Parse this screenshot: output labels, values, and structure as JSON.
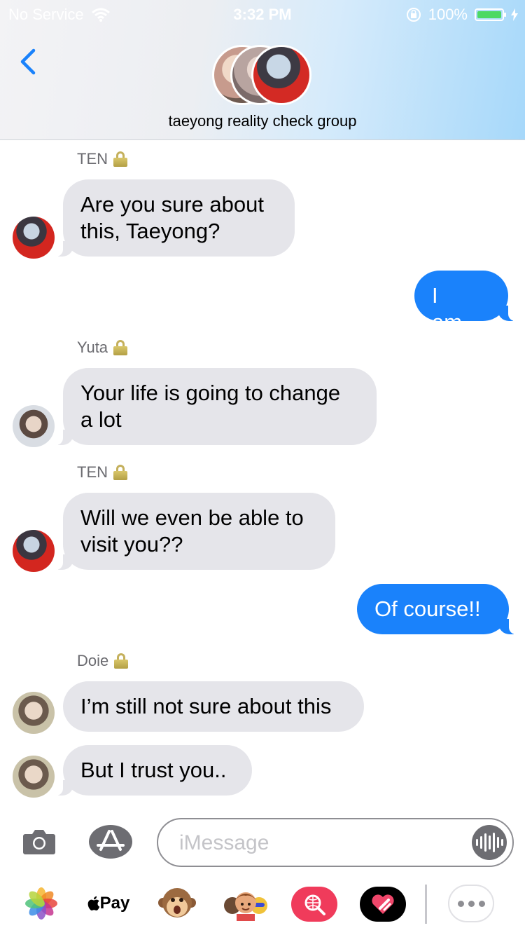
{
  "status_bar": {
    "carrier": "No Service",
    "time": "3:32 PM",
    "battery": "100%"
  },
  "header": {
    "group_name": "taeyong reality check group"
  },
  "messages": [
    {
      "sender": "TEN",
      "text_l1": "Are you sure about",
      "text_l2": "this, Taeyong?"
    },
    {
      "text": "I am..."
    },
    {
      "sender": "Yuta",
      "text_l1": "Your life is going to change",
      "text_l2": "a lot"
    },
    {
      "sender": "TEN",
      "text_l1": "Will we even be able to",
      "text_l2": "visit you??"
    },
    {
      "text": "Of course!!"
    },
    {
      "sender": "Doie",
      "text": "I’m still not sure about this"
    },
    {
      "text": "But I trust you.."
    }
  ],
  "input": {
    "placeholder": "iMessage",
    "value": ""
  },
  "app_drawer": {
    "apple_pay_label": "Pay"
  },
  "colors": {
    "outgoing_bubble": "#1a82fb",
    "incoming_bubble": "#e5e5ea",
    "back_chevron": "#1a82fb",
    "search_app": "#f03b5b"
  },
  "icons": [
    "back-chevron-icon",
    "wifi-icon",
    "orientation-lock-icon",
    "battery-icon",
    "lock-icon",
    "camera-icon",
    "app-store-icon",
    "audio-waveform-icon",
    "photos-app-icon",
    "apple-pay-icon",
    "monkey-animoji-icon",
    "memoji-icon",
    "search-app-icon",
    "digital-touch-icon",
    "more-apps-icon"
  ]
}
